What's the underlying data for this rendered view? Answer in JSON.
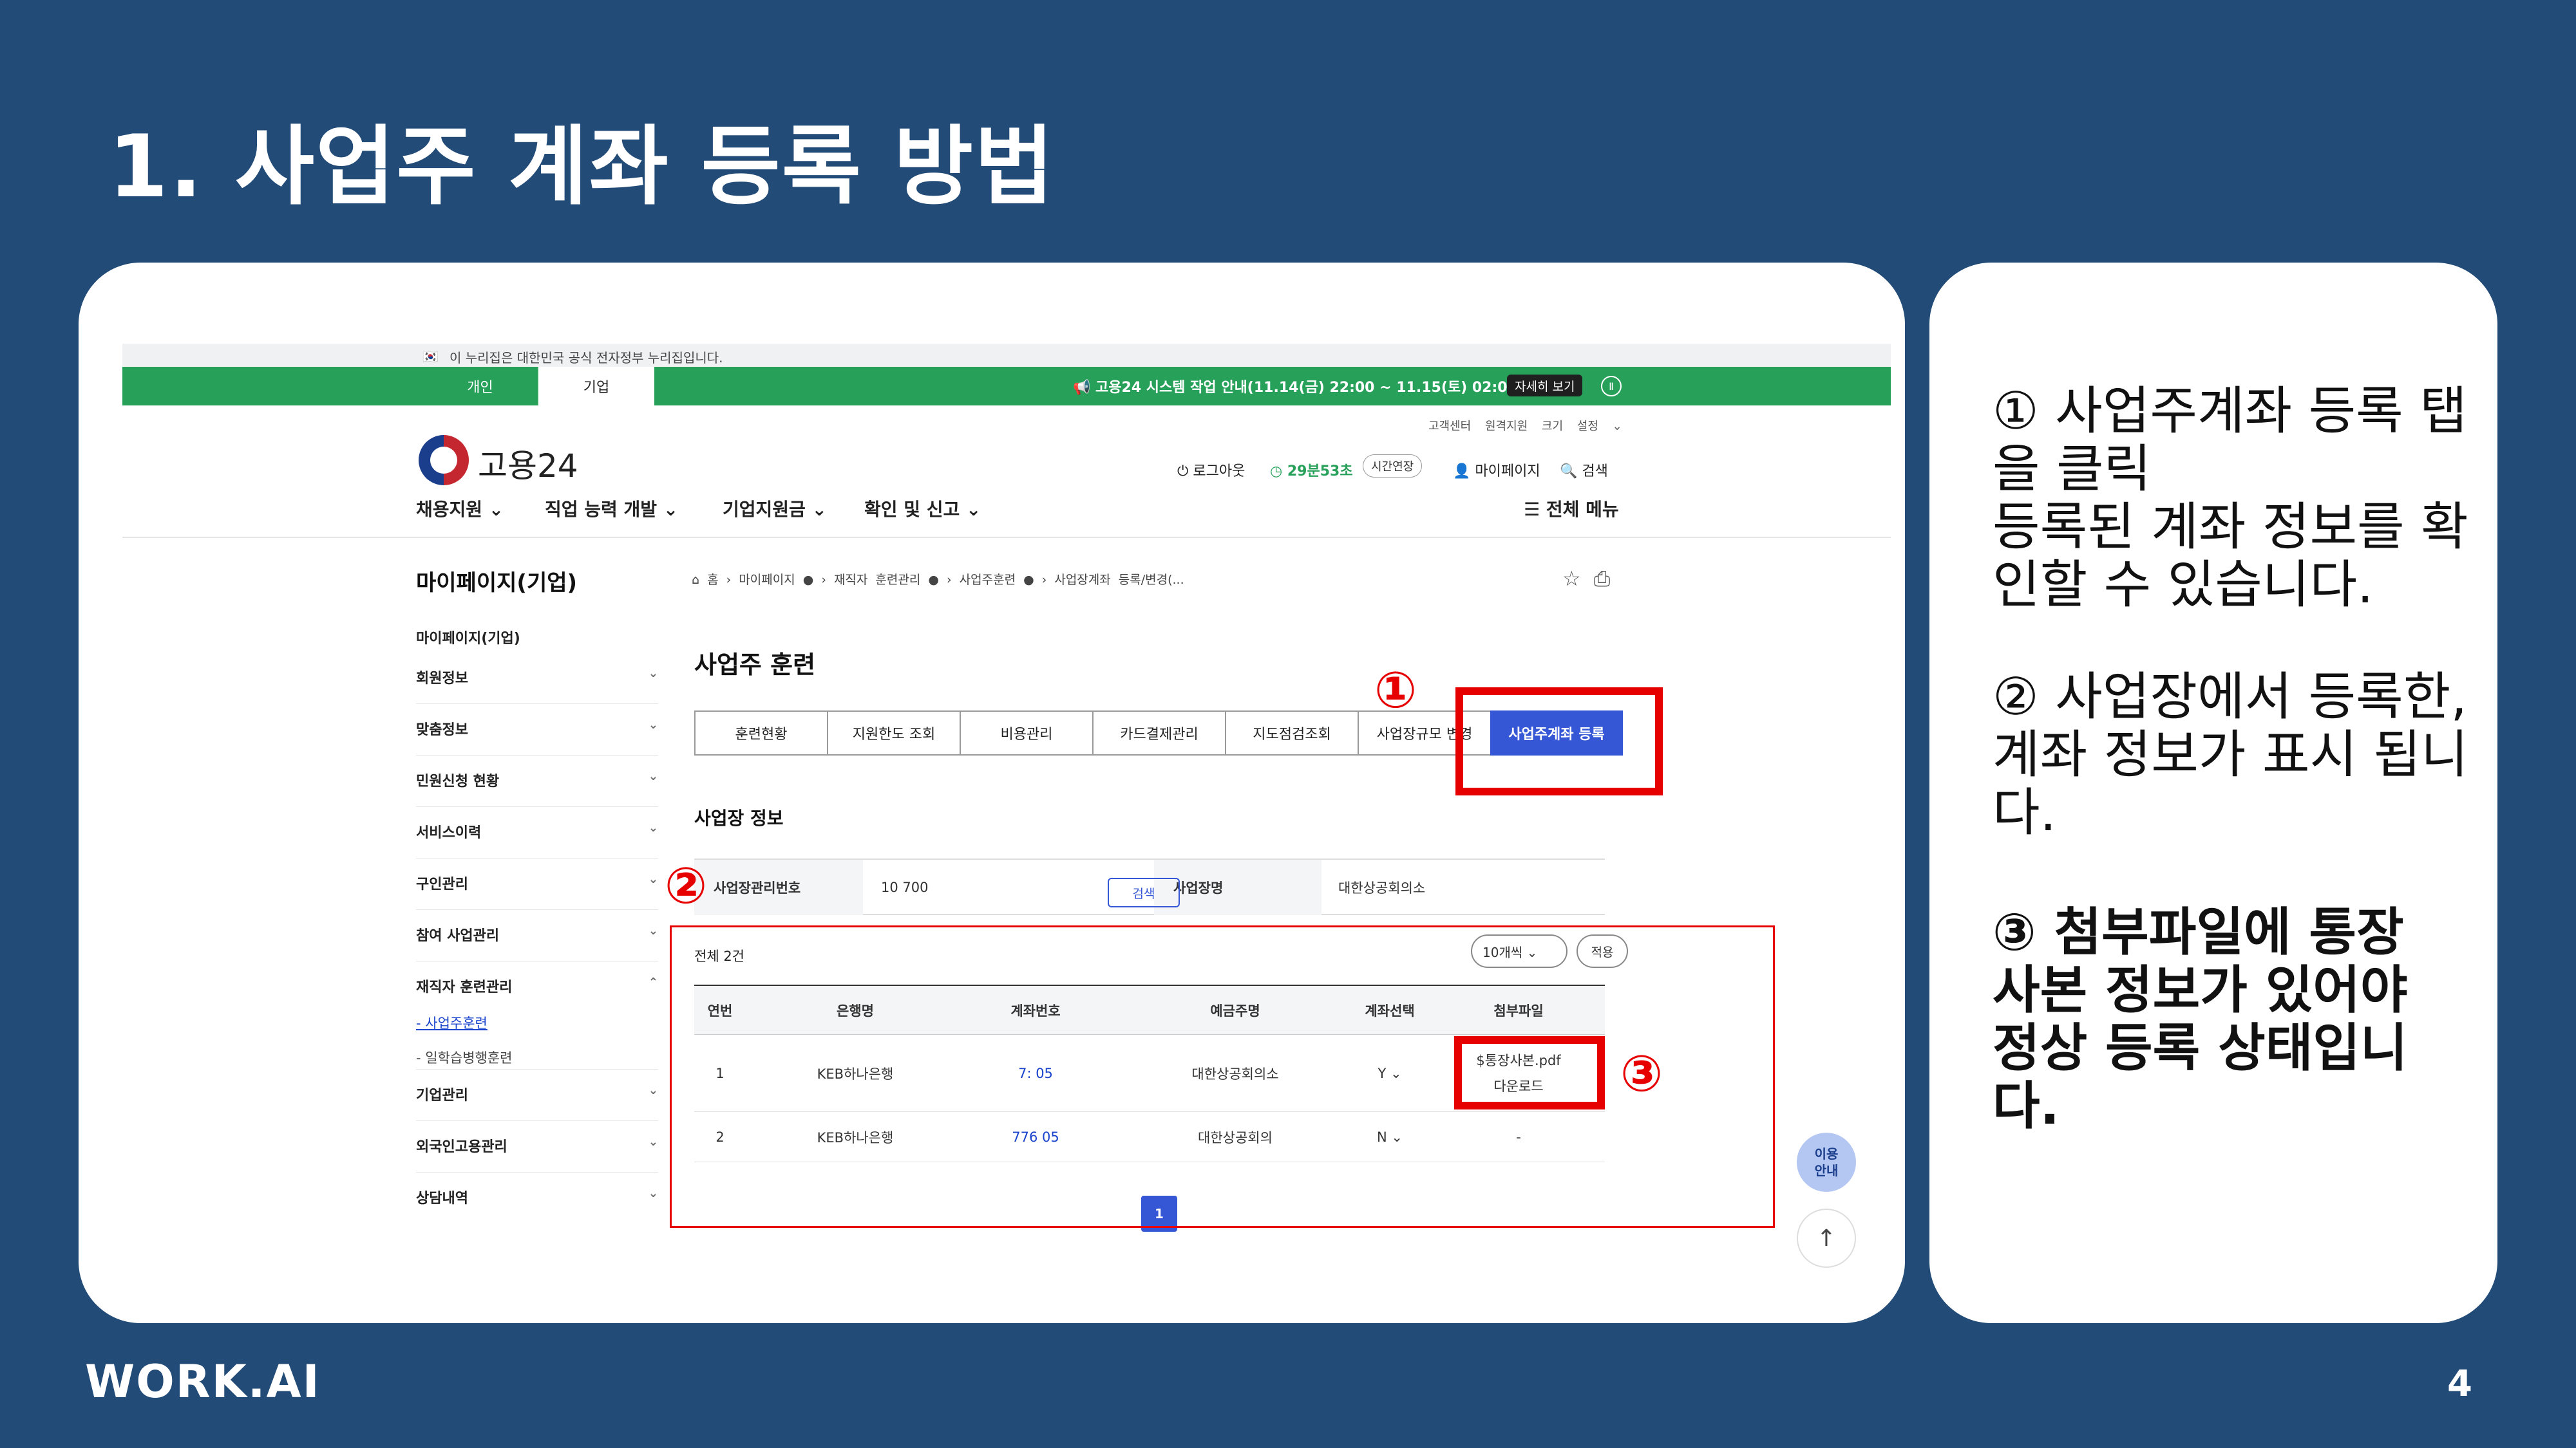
{
  "slide": {
    "title": "1. 사업주 계좌 등록 방법",
    "brand": "WORK.AI",
    "page_number": "4"
  },
  "gov_bar": {
    "flag": "🇰🇷",
    "text": "이 누리집은 대한민국 공식 전자정부 누리집입니다."
  },
  "top_bar": {
    "tab_personal": "개인",
    "tab_corp": "기업",
    "notice": "📢 고용24 시스템 작업 안내(11.14(금) 22:00 ~ 11.15(토) 02:00)",
    "notice_button": "자세히 보기",
    "pause": "Ⅱ"
  },
  "header": {
    "util_links": "고객센터 원격지원 크기 설정 ⌄",
    "logo_text": "고용24",
    "logout": "⏻ 로그아웃",
    "timer": "◷ 29분53초",
    "extend": "시간연장",
    "mypage": "👤 마이페이지",
    "search": "🔍 검색",
    "all_menu": "☰ 전체 메뉴"
  },
  "gnb": [
    "채용지원 ⌄",
    "직업 능력 개발 ⌄",
    "기업지원금 ⌄",
    "확인 및 신고 ⌄"
  ],
  "lnb": {
    "title": "마이페이지(기업)",
    "items": [
      "마이페이지(기업)",
      "회원정보",
      "맞춤정보",
      "민원신청 현황",
      "서비스이력",
      "구인관리",
      "참여 사업관리",
      "재직자 훈련관리",
      "기업관리",
      "외국인고용관리",
      "상담내역"
    ],
    "sub_active": "- 사업주훈련",
    "sub_other": "- 일학습병행훈련",
    "chevron_down": "⌄",
    "chevron_up": "⌃"
  },
  "breadcrumb": "⌂ 홈 › 마이페이지 ● › 재직자 훈련관리 ● › 사업주훈련 ● › 사업장계좌 등록/변경(...",
  "page_tools": "☆⎙",
  "section_title": "사업주 훈련",
  "tabs": [
    "훈련현황",
    "지원한도 조회",
    "비용관리",
    "카드결제관리",
    "지도점검조회",
    "사업장규모 변경",
    "사업주계좌 등록"
  ],
  "workplace": {
    "title": "사업장 정보",
    "reg_label": "사업장관리번호",
    "reg_value": "10            700",
    "search_button": "검색",
    "name_label": "사업장명",
    "name_value": "대한상공회의소"
  },
  "account_table": {
    "total": "전체 2건",
    "per_page": "10개씩 ⌄",
    "apply": "적용",
    "headers": [
      "연번",
      "은행명",
      "계좌번호",
      "예금주명",
      "계좌선택",
      "첨부파일"
    ],
    "rows": [
      {
        "no": "1",
        "bank": "KEB하나은행",
        "account": "7:                05",
        "holder": "대한상공회의소",
        "select": "Y ⌄",
        "file_name": "$통장사본.pdf",
        "file_action": "다운로드"
      },
      {
        "no": "2",
        "bank": "KEB하나은행",
        "account": "776              05",
        "holder": "대한상공회의",
        "select": "N ⌄",
        "file_name": "-",
        "file_action": ""
      }
    ],
    "page": "1"
  },
  "floating": {
    "help": "이용\n안내",
    "top": "↑"
  },
  "markers": {
    "m1": "①",
    "m2": "②",
    "m3": "③"
  },
  "side_notes": {
    "p1": "① 사업주계좌 등록 탭을 클릭\n등록된 계좌 정보를 확인할 수 있습니다.",
    "p2": "② 사업장에서 등록한, 계좌 정보가 표시 됩니다.",
    "p3": "③ 첨부파일에 통장 사본 정보가 있어야 정상 등록 상태입니다."
  },
  "colors": {
    "background": "#224c77",
    "green_bar": "#27a05a",
    "accent_blue": "#3557d6",
    "highlight_red": "#e60000"
  }
}
